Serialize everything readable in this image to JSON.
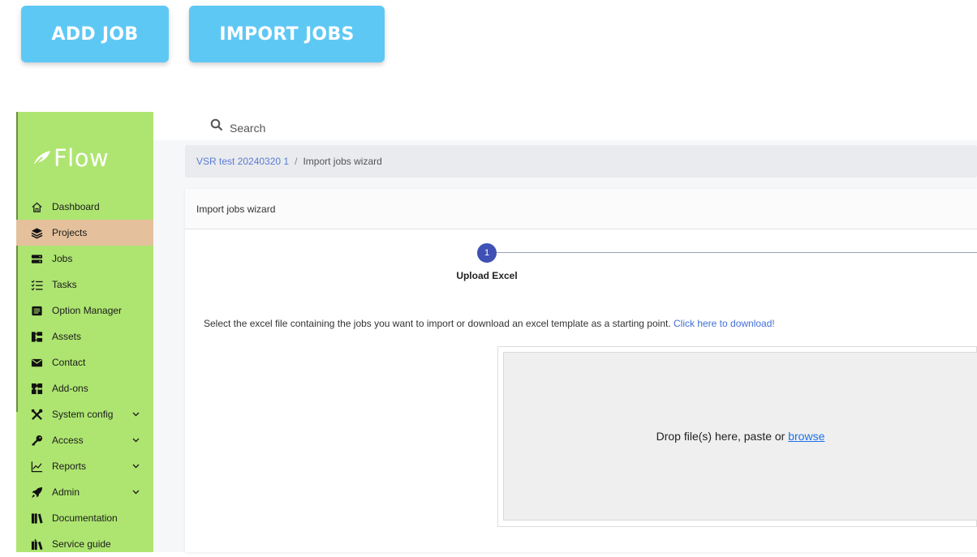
{
  "top_buttons": {
    "add_job": "ADD JOB",
    "import_jobs": "IMPORT JOBS"
  },
  "brand": {
    "name": "Flow"
  },
  "sidebar": {
    "items": [
      {
        "label": "Dashboard",
        "icon": "home-icon"
      },
      {
        "label": "Projects",
        "icon": "layers-icon",
        "active": true
      },
      {
        "label": "Jobs",
        "icon": "jobs-icon"
      },
      {
        "label": "Tasks",
        "icon": "tasks-icon"
      },
      {
        "label": "Option Manager",
        "icon": "list-box-icon"
      },
      {
        "label": "Assets",
        "icon": "assets-icon"
      },
      {
        "label": "Contact",
        "icon": "envelope-icon"
      },
      {
        "label": "Add-ons",
        "icon": "puzzle-icon"
      },
      {
        "label": "System config",
        "icon": "tools-icon",
        "expandable": true
      },
      {
        "label": "Access",
        "icon": "key-icon",
        "expandable": true
      },
      {
        "label": "Reports",
        "icon": "chart-icon",
        "expandable": true
      },
      {
        "label": "Admin",
        "icon": "rocket-icon",
        "expandable": true
      },
      {
        "label": "Documentation",
        "icon": "books-icon"
      },
      {
        "label": "Service guide",
        "icon": "guide-icon"
      }
    ]
  },
  "search": {
    "placeholder": "Search"
  },
  "breadcrumb": {
    "project": "VSR test 20240320 1",
    "separator": "/",
    "current": "Import jobs wizard"
  },
  "card": {
    "title": "Import jobs wizard"
  },
  "stepper": {
    "number": "1",
    "label": "Upload Excel"
  },
  "instructions": {
    "text": "Select the excel file containing the jobs you want to import or download an excel template as a starting point. ",
    "link": "Click here to download!"
  },
  "dropzone": {
    "text": "Drop file(s) here, paste or ",
    "browse": "browse"
  },
  "colors": {
    "button": "#5ec8f5",
    "sidebar": "#aee571",
    "sidebar_active": "#e4c19c",
    "stepper": "#3f51b5",
    "link": "#3f6fd8"
  }
}
